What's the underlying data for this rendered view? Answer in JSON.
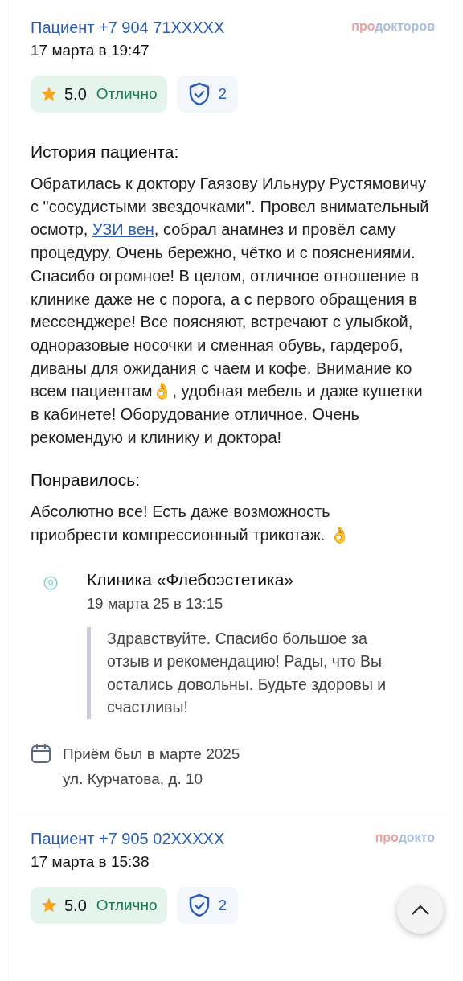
{
  "reviews": [
    {
      "author": "Пациент +7 904 71XXXXX",
      "logo_prefix": "про",
      "logo_rest": "докторов",
      "date": "17 марта в 19:47",
      "rating": "5.0",
      "rating_label": "Отлично",
      "verified_count": "2",
      "story_heading": "История пациента:",
      "story": [
        {
          "kind": "text",
          "text": "Обратилась к доктору Гаязову Ильнуру Рустямовичу с \"сосудистыми звездочками\". Провел внимательный осмотр, "
        },
        {
          "kind": "link",
          "text": "УЗИ вен"
        },
        {
          "kind": "text",
          "text": ", собрал анамнез и провёл саму процедуру. Очень бережно, чётко и с пояснениями. Спасибо огромное! В целом, отличное отношение в клинике даже не с порога, а с первого обращения в мессенджере! Все поясняют, встречают с улыбкой, одноразовые носочки и сменная обувь, гардероб, диваны для ожидания с чаем и кофе. Внимание ко всем пациентам👌, удобная мебель и даже кушетки в кабинете! Оборудование отличное. Очень рекомендую и клинику и доктора!"
        }
      ],
      "liked_heading": "Понравилось:",
      "liked": "Абсолютно все! Есть даже возможность приобрести компрессионный трикотаж. 👌",
      "reply": {
        "clinic": "Клиника «Флебоэстетика»",
        "date": "19 марта 25 в 13:15",
        "text": "Здравствуйте. Спасибо большое за отзыв и рекомендацию! Рады, что Вы остались довольны. Будьте здоровы и счастливы!"
      },
      "visit": "Приём был в марте 2025",
      "address": "ул. Курчатова, д. 10"
    },
    {
      "author": "Пациент +7 905 02XXXXX",
      "logo_prefix": "про",
      "logo_rest": "докто",
      "date": "17 марта в 15:38",
      "rating": "5.0",
      "rating_label": "Отлично",
      "verified_count": "2"
    }
  ]
}
